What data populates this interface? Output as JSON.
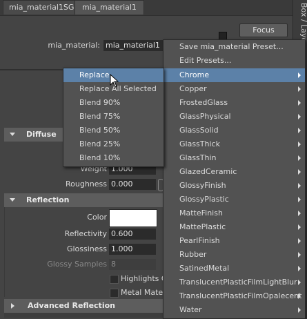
{
  "tabs": [
    {
      "label": "mia_material1SG"
    },
    {
      "label": "mia_material1"
    }
  ],
  "side_tab": "Box / Layer",
  "header": {
    "node_label": "mia_material:",
    "node_value": "mia_material1",
    "focus_label": "Focus"
  },
  "sections": {
    "diffuse": "Diffuse",
    "reflection": "Reflection",
    "advanced_reflection": "Advanced Reflection"
  },
  "diffuse": {
    "weight_label": "Weight",
    "weight_value": "1.000",
    "roughness_label": "Roughness",
    "roughness_value": "0.000"
  },
  "reflection": {
    "color_label": "Color",
    "color_value": "#ffffff",
    "reflectivity_label": "Reflectivity",
    "reflectivity_value": "0.600",
    "glossiness_label": "Glossiness",
    "glossiness_value": "1.000",
    "glossy_samples_label": "Glossy Samples",
    "glossy_samples_value": "8",
    "highlights_only_label": "Highlights Or",
    "metal_material_label": "Metal Materi"
  },
  "preset_menu": {
    "items": [
      {
        "label": "Save mia_material Preset..."
      },
      {
        "label": "Edit Presets..."
      },
      {
        "label": "Chrome"
      },
      {
        "label": "Copper"
      },
      {
        "label": "FrostedGlass"
      },
      {
        "label": "GlassPhysical"
      },
      {
        "label": "GlassSolid"
      },
      {
        "label": "GlassThick"
      },
      {
        "label": "GlassThin"
      },
      {
        "label": "GlazedCeramic"
      },
      {
        "label": "GlossyFinish"
      },
      {
        "label": "GlossyPlastic"
      },
      {
        "label": "MatteFinish"
      },
      {
        "label": "MattePlastic"
      },
      {
        "label": "PearlFinish"
      },
      {
        "label": "Rubber"
      },
      {
        "label": "SatinedMetal"
      },
      {
        "label": "TranslucentPlasticFilmLightBlur"
      },
      {
        "label": "TranslucentPlasticFilmOpalecent"
      },
      {
        "label": "Water"
      }
    ]
  },
  "blend_menu": {
    "items": [
      {
        "label": "Replace"
      },
      {
        "label": "Replace All Selected"
      },
      {
        "label": "Blend 90%"
      },
      {
        "label": "Blend 75%"
      },
      {
        "label": "Blend 50%"
      },
      {
        "label": "Blend 25%"
      },
      {
        "label": "Blend 10%"
      }
    ]
  }
}
